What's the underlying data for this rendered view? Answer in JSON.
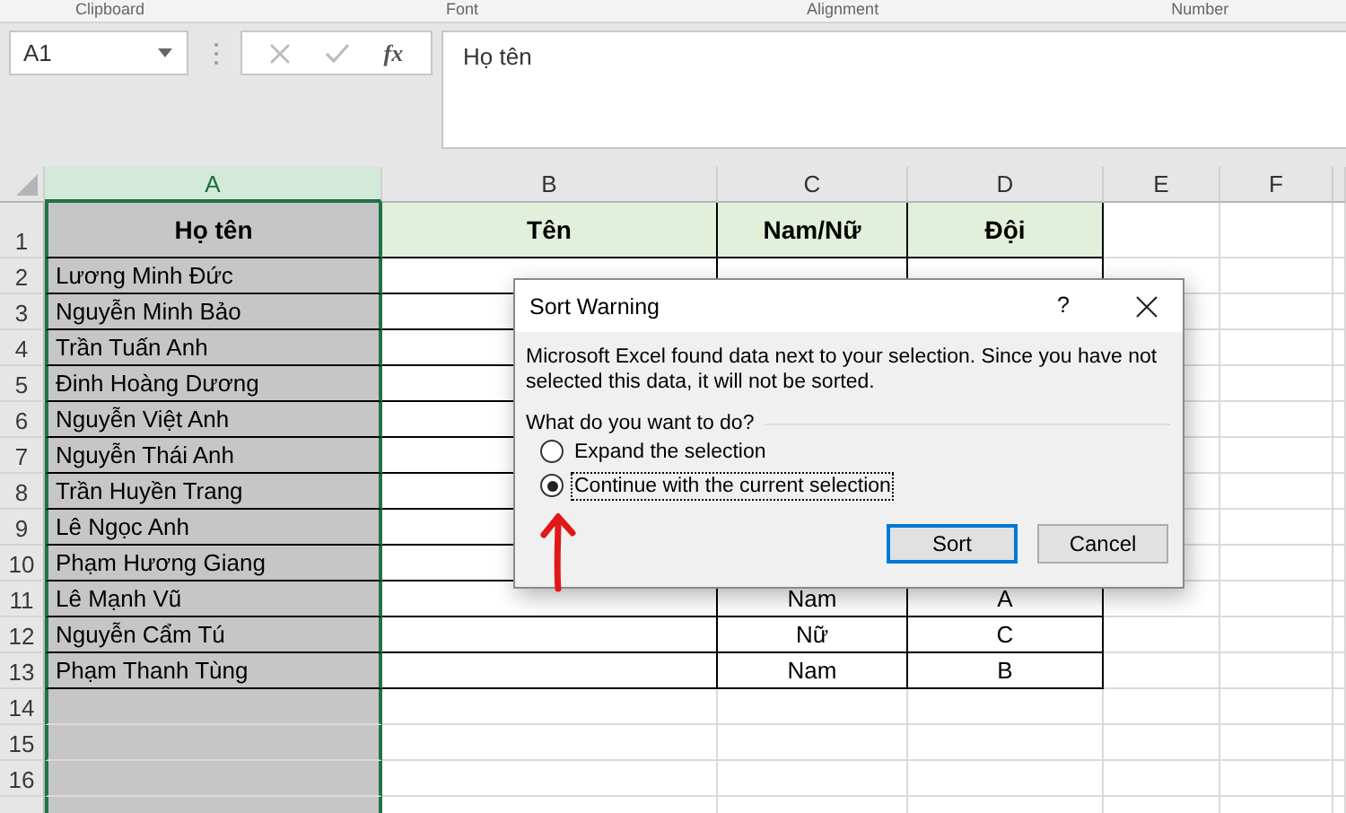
{
  "ribbon_groups": [
    "Clipboard",
    "Font",
    "Alignment",
    "Number"
  ],
  "name_box": {
    "value": "A1"
  },
  "formula_bar": {
    "function_label": "fx",
    "value": "Họ tên"
  },
  "columns": [
    {
      "label": "A",
      "selected": true
    },
    {
      "label": "B",
      "selected": false
    },
    {
      "label": "C",
      "selected": false
    },
    {
      "label": "D",
      "selected": false
    },
    {
      "label": "E",
      "selected": false
    },
    {
      "label": "F",
      "selected": false
    }
  ],
  "header_row": {
    "number": "1",
    "cells": [
      "Họ tên",
      "Tên",
      "Nam/Nữ",
      "Đội"
    ]
  },
  "rows": [
    {
      "number": "2",
      "name": "Lương Minh Đức"
    },
    {
      "number": "3",
      "name": "Nguyễn Minh Bảo"
    },
    {
      "number": "4",
      "name": "Trần Tuấn Anh"
    },
    {
      "number": "5",
      "name": "Đinh Hoàng Dương"
    },
    {
      "number": "6",
      "name": "Nguyễn Việt Anh"
    },
    {
      "number": "7",
      "name": "Nguyễn Thái Anh"
    },
    {
      "number": "8",
      "name": "Trần Huyền Trang"
    },
    {
      "number": "9",
      "name": "Lê Ngọc Anh"
    },
    {
      "number": "10",
      "name": "Phạm Hương Giang"
    },
    {
      "number": "11",
      "name": "Lê Mạnh Vũ",
      "gender": "Nam",
      "team": "A"
    },
    {
      "number": "12",
      "name": "Nguyễn Cẩm Tú",
      "gender": "Nữ",
      "team": "C"
    },
    {
      "number": "13",
      "name": "Phạm Thanh Tùng",
      "gender": "Nam",
      "team": "B"
    }
  ],
  "empty_rows": [
    "14",
    "15",
    "16"
  ],
  "dialog": {
    "title": "Sort Warning",
    "help": "?",
    "message": "Microsoft Excel found data next to your selection.  Since you have not selected this data, it will not be sorted.",
    "question": "What do you want to do?",
    "options": [
      {
        "label": "Expand the selection",
        "selected": false
      },
      {
        "label": "Continue with the current selection",
        "selected": true
      }
    ],
    "buttons": [
      {
        "label": "Sort",
        "default": true
      },
      {
        "label": "Cancel",
        "default": false
      }
    ]
  }
}
